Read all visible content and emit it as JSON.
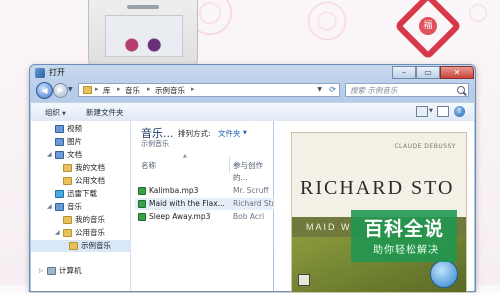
{
  "window": {
    "title": "打开",
    "buttons": {
      "minimize": "–",
      "maximize": "▭",
      "close": "✕"
    }
  },
  "address": {
    "crumbs": [
      "库",
      "音乐",
      "示例音乐"
    ],
    "search_placeholder": "搜索 示例音乐"
  },
  "toolbar": {
    "organize": "组织",
    "new_folder": "新建文件夹"
  },
  "nav": {
    "items": [
      {
        "label": "视频",
        "icon": "video-library-icon",
        "level": 1
      },
      {
        "label": "图片",
        "icon": "pictures-library-icon",
        "level": 1
      },
      {
        "label": "文档",
        "icon": "documents-library-icon",
        "level": 1
      },
      {
        "label": "我的文档",
        "icon": "folder-icon",
        "level": 2
      },
      {
        "label": "公用文档",
        "icon": "folder-icon",
        "level": 2
      },
      {
        "label": "迅雷下载",
        "icon": "thunder-icon",
        "level": 1
      },
      {
        "label": "音乐",
        "icon": "music-library-icon",
        "level": 1
      },
      {
        "label": "我的音乐",
        "icon": "folder-icon",
        "level": 2
      },
      {
        "label": "公用音乐",
        "icon": "folder-icon",
        "level": 2
      },
      {
        "label": "示例音乐",
        "icon": "folder-icon",
        "level": 3,
        "selected": true
      },
      {
        "label": "计算机",
        "icon": "computer-icon",
        "level": 0
      }
    ]
  },
  "filelist": {
    "library_title": "音乐...",
    "library_subtitle": "示例音乐",
    "arrange_label": "排列方式:",
    "arrange_value": "文件夹",
    "columns": [
      "名称",
      "参与创作的..."
    ],
    "rows": [
      {
        "name": "Kalimba.mp3",
        "artist": "Mr. Scruff"
      },
      {
        "name": "Maid with the Flax...",
        "artist": "Richard Sto",
        "selected": true
      },
      {
        "name": "Sleep Away.mp3",
        "artist": "Bob Acri"
      }
    ]
  },
  "preview": {
    "composer": "CLAUDE DEBUSSY",
    "artist": "RICHARD STO",
    "album_band": "MAID W"
  },
  "watermark": {
    "title": "百科全说",
    "subtitle": "助你轻松解决"
  }
}
